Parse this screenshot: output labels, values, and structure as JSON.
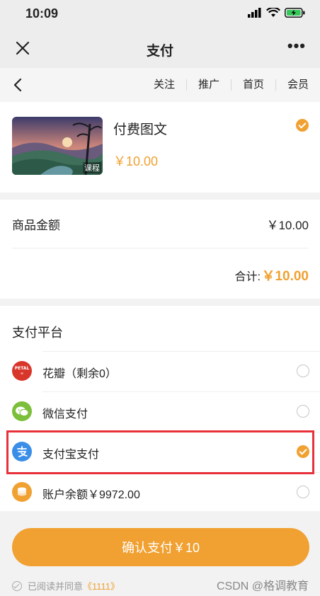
{
  "status_bar": {
    "time": "10:09"
  },
  "titlebar": {
    "title": "支付",
    "more": "•••"
  },
  "nav": {
    "links": [
      "关注",
      "推广",
      "首页",
      "会员"
    ]
  },
  "product": {
    "name": "付费图文",
    "price": "￥10.00",
    "tag": "课程"
  },
  "amount": {
    "label": "商品金额",
    "value": "￥10.00",
    "total_label": "合计:",
    "total_value": "￥10.00"
  },
  "payment": {
    "title": "支付平台",
    "options": [
      {
        "label": "花瓣（剩余0）",
        "icon": "huaban-icon",
        "color": "#d9362b",
        "selected": false
      },
      {
        "label": "微信支付",
        "icon": "wechat-icon",
        "color": "#7bbf3a",
        "selected": false
      },
      {
        "label": "支付宝支付",
        "icon": "alipay-icon",
        "color": "#3b8ee8",
        "selected": true
      },
      {
        "label": "账户余额￥9972.00",
        "icon": "balance-icon",
        "color": "#f0a132",
        "selected": false
      }
    ]
  },
  "confirm_label": "确认支付￥10",
  "agreement": {
    "text": "已阅读并同意",
    "link": "《1111》"
  },
  "watermark": "CSDN @格调教育",
  "colors": {
    "accent": "#f0a132",
    "highlight": "#e8303a"
  }
}
